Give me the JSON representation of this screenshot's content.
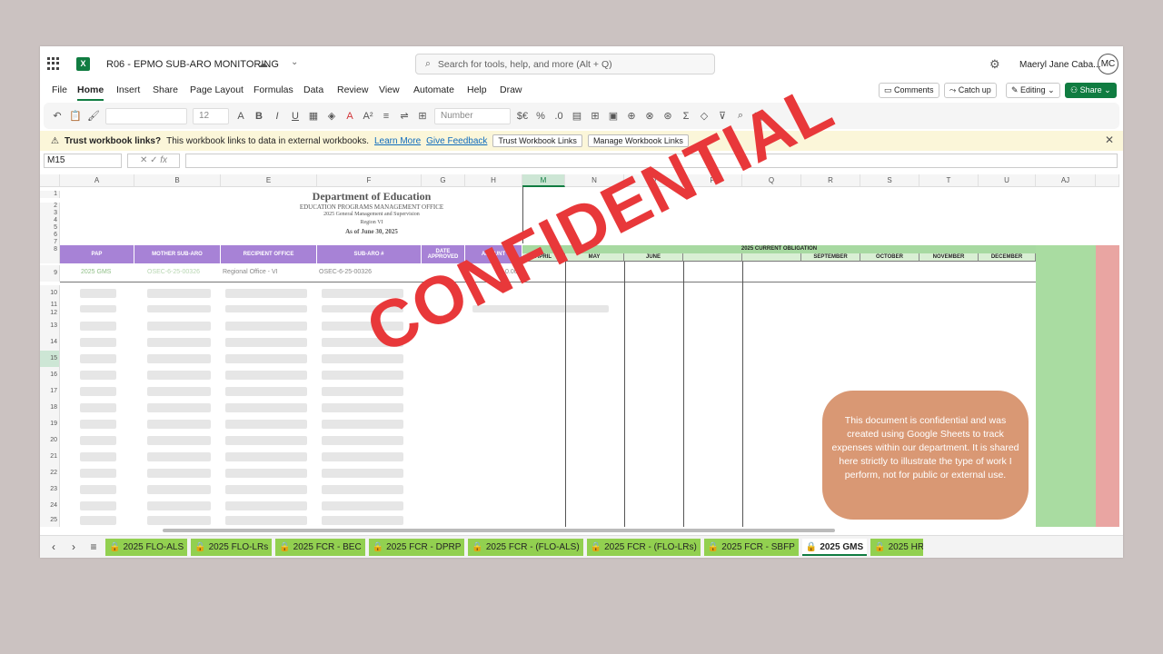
{
  "window": {
    "doc_title": "R06  - EPMO SUB-ARO MONITORING",
    "user_name": "Maeryl Jane Caba...",
    "user_initials": "MC"
  },
  "search": {
    "placeholder": "Search for tools, help, and more (Alt + Q)"
  },
  "menu": [
    "File",
    "Home",
    "Insert",
    "Share",
    "Page Layout",
    "Formulas",
    "Data",
    "Review",
    "View",
    "Automate",
    "Help",
    "Draw"
  ],
  "buttons": {
    "comments": "Comments",
    "catchup": "Catch up",
    "editing": "Editing",
    "share": "Share"
  },
  "ribbon": {
    "font_size": "12",
    "number_format": "Number"
  },
  "message": {
    "title": "Trust workbook links?",
    "text": "This workbook links to data in external workbooks.",
    "learn": "Learn More",
    "feedback": "Give Feedback",
    "trust_btn": "Trust Workbook Links",
    "manage_btn": "Manage Workbook Links"
  },
  "formula": {
    "namebox": "M15",
    "fx": "fx"
  },
  "columns": [
    "A",
    "B",
    "E",
    "F",
    "G",
    "H",
    "M",
    "N",
    "O",
    "P",
    "Q",
    "R",
    "S",
    "T",
    "U",
    "AJ"
  ],
  "rows": [
    "1",
    "2",
    "3",
    "4",
    "5",
    "6",
    "7",
    "8",
    "9",
    "10",
    "11",
    "12",
    "13",
    "14",
    "15",
    "16",
    "17",
    "18",
    "19",
    "20",
    "21",
    "22",
    "23",
    "24",
    "25"
  ],
  "sheet": {
    "dept": "Department of Education",
    "office": "EDUCATION PROGRAMS MANAGEMENT OFFICE",
    "sub": "2025 General Management and Supervision",
    "region": "Region VI",
    "asof": "As of June 30, 2025",
    "headers": [
      "PAP",
      "MOTHER SUB-ARO",
      "RECIPIENT OFFICE",
      "SUB-ARO #",
      "DATE APPROVED",
      "AMOUNT"
    ],
    "band": "2025 CURRENT OBLIGATION",
    "months": [
      "APRIL",
      "MAY",
      "JUNE",
      "",
      "",
      "SEPTEMBER",
      "OCTOBER",
      "NOVEMBER",
      "DECEMBER"
    ],
    "row9": {
      "pap": "2025 GMS",
      "mother": "OSEC-6-25-00326",
      "office": "Regional Office - VI",
      "subaro": "OSEC-6-25-00326",
      "amount": "0.00"
    }
  },
  "overlay": {
    "stamp": "CONFIDENTIAL",
    "note": "This document is confidential and was created using Google Sheets to track expenses within our department. It is shared here strictly to illustrate the type of work I perform, not for public or external use."
  },
  "tabs": [
    "2025 FLO-ALS",
    "2025 FLO-LRs",
    "2025 FCR - BEC",
    "2025 FCR - DPRP",
    "2025 FCR - (FLO-ALS)",
    "2025 FCR - (FLO-LRs)",
    "2025 FCR - SBFP",
    "2025 GMS",
    "2025 HR"
  ]
}
